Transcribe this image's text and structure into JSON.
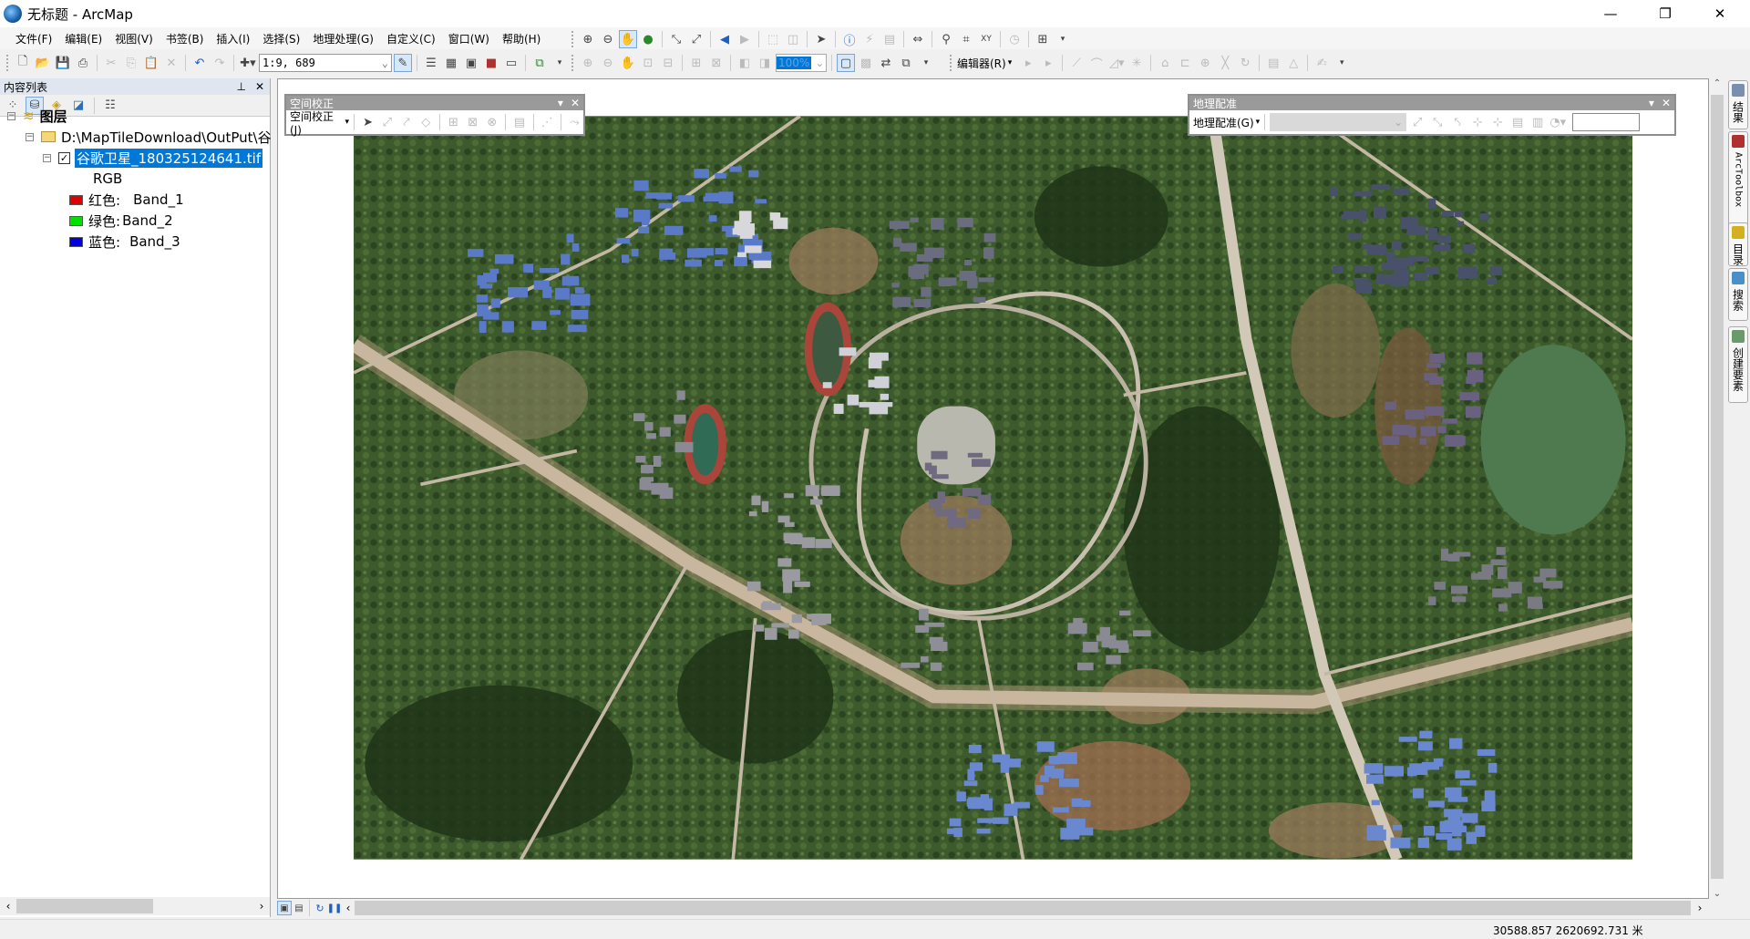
{
  "window": {
    "title": "无标题 - ArcMap",
    "minimize_icon": "minimize-icon",
    "restore_icon": "restore-icon",
    "close_icon": "close-icon"
  },
  "menu": [
    "文件(F)",
    "编辑(E)",
    "视图(V)",
    "书签(B)",
    "插入(I)",
    "选择(S)",
    "地理处理(G)",
    "自定义(C)",
    "窗口(W)",
    "帮助(H)"
  ],
  "standard_toolbar": {
    "scale": "1:9, 689"
  },
  "layout_toolbar": {
    "zoom_percent": "100%"
  },
  "editor_toolbar": {
    "label": "编辑器(R)"
  },
  "toc": {
    "title": "内容列表",
    "root": "图层",
    "folder": "D:\\MapTileDownload\\OutPut\\谷",
    "layer": "谷歌卫星_180325124641.tif",
    "layer_checked": true,
    "renderer": "RGB",
    "bands": [
      {
        "label": "红色:",
        "band": "Band_1",
        "color": "#e00000"
      },
      {
        "label": "绿色:",
        "band": "Band_2",
        "color": "#00e000"
      },
      {
        "label": "蓝色:",
        "band": "Band_3",
        "color": "#0000e0"
      }
    ]
  },
  "spatial_adjustment": {
    "caption": "空间校正",
    "menu": "空间校正(J)"
  },
  "georeferencing": {
    "caption": "地理配准",
    "menu": "地理配准(G)",
    "layer_select": "",
    "input": ""
  },
  "right_dock": [
    "结果",
    "ArcToolbox",
    "目录",
    "搜索",
    "创建要素"
  ],
  "status": {
    "coordinates": "30588.857   2620692.731 米"
  },
  "colors": {
    "selection": "#0078d7",
    "toc_header": "#dfe6ef"
  }
}
